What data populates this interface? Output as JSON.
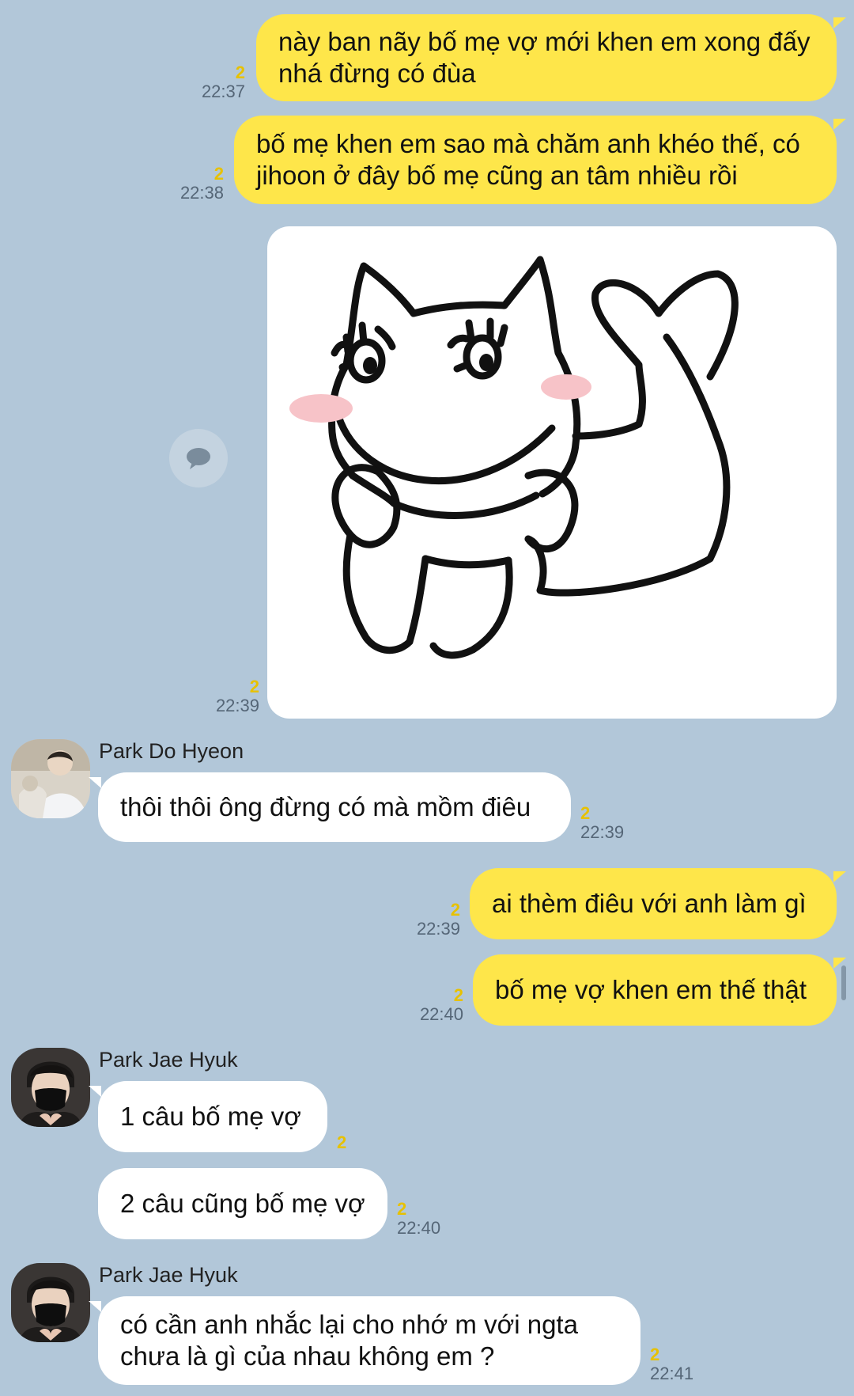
{
  "theme": {
    "background": "#b2c7d9",
    "my_bubble": "#fee64a",
    "their_bubble": "#ffffff",
    "unread_color": "#e7c100"
  },
  "messages": [
    {
      "from": "me",
      "text": "này ban nãy bố mẹ vợ mới khen em xong đấy\nnhá đừng có đùa",
      "unread": "2",
      "time": "22:37"
    },
    {
      "from": "me",
      "text": "bố mẹ khen em sao mà chăm anh khéo thế, có\njihoon ở đây bố mẹ cũng an tâm nhiều rồi",
      "unread": "2",
      "time": "22:38"
    },
    {
      "from": "me",
      "type": "image",
      "image": "cat-doodle-sticker",
      "unread": "2",
      "time": "22:39"
    },
    {
      "from": "Park Do Hyeon",
      "text": "thôi thôi ông đừng có mà mồm điêu",
      "unread": "2",
      "time": "22:39"
    },
    {
      "from": "me",
      "text": "ai thèm điêu với anh làm gì",
      "unread": "2",
      "time": "22:39"
    },
    {
      "from": "me",
      "text": "bố mẹ vợ khen em thế thật",
      "unread": "2",
      "time": "22:40"
    },
    {
      "from": "Park Jae Hyuk",
      "text": "1 câu bố mẹ vợ",
      "unread": "2",
      "time": ""
    },
    {
      "from": "Park Jae Hyuk",
      "text": "2 câu cũng bố mẹ vợ",
      "unread": "2",
      "time": "22:40"
    },
    {
      "from": "Park Jae Hyuk",
      "text": "có cần anh nhắc lại cho nhớ m với ngta\nchưa là gì của nhau không em ?",
      "unread": "2",
      "time": "22:41"
    }
  ],
  "senders": {
    "dohyeon": "Park Do Hyeon",
    "jaehyuk_1": "Park Jae Hyuk",
    "jaehyuk_2": "Park Jae Hyuk"
  },
  "icons": {
    "share": "speech-bubble-icon"
  }
}
